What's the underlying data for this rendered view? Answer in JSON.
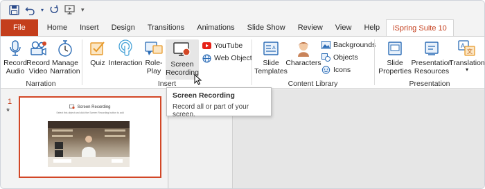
{
  "quick_access": {
    "icons": [
      "save-icon",
      "undo-icon",
      "undo-dropdown-icon",
      "redo-icon",
      "present-from-beginning-icon",
      "customize-toolbar-icon"
    ]
  },
  "tabs": [
    {
      "label": "File",
      "name": "tab-file"
    },
    {
      "label": "Home",
      "name": "tab-home"
    },
    {
      "label": "Insert",
      "name": "tab-insert"
    },
    {
      "label": "Design",
      "name": "tab-design"
    },
    {
      "label": "Transitions",
      "name": "tab-transitions"
    },
    {
      "label": "Animations",
      "name": "tab-animations"
    },
    {
      "label": "Slide Show",
      "name": "tab-slide-show"
    },
    {
      "label": "Review",
      "name": "tab-review"
    },
    {
      "label": "View",
      "name": "tab-view"
    },
    {
      "label": "Help",
      "name": "tab-help"
    },
    {
      "label": "iSpring Suite 10",
      "name": "tab-ispring-suite"
    }
  ],
  "ribbon": {
    "narration": {
      "label": "Narration",
      "record_audio": "Record\nAudio",
      "record_video": "Record\nVideo",
      "manage_narration": "Manage\nNarration"
    },
    "insert": {
      "label": "Insert",
      "quiz": "Quiz",
      "interaction": "Interaction",
      "role_play": "Role-\nPlay",
      "screen_recording": "Screen\nRecording",
      "youtube": "YouTube",
      "web_object": "Web Object"
    },
    "content_library": {
      "label": "Content Library",
      "slide_templates": "Slide\nTemplates",
      "characters": "Characters",
      "backgrounds": "Backgrounds",
      "objects": "Objects",
      "icons": "Icons"
    },
    "presentation": {
      "label": "Presentation",
      "slide_properties": "Slide\nProperties",
      "presentation_resources": "Presentation\nResources",
      "translation": "Translation"
    }
  },
  "slides_pane": {
    "slide_number": "1",
    "slide_marker": "*",
    "thumbnail_title": "Screen Recording",
    "thumbnail_subtitle": "Select this object and click the Screen Recording button to add"
  },
  "tooltip": {
    "title": "Screen Recording",
    "description": "Record all or part of your screen."
  },
  "colors": {
    "accent": "#c43e1c",
    "file_tab": "#c43e1c",
    "slide_border": "#d24726"
  }
}
